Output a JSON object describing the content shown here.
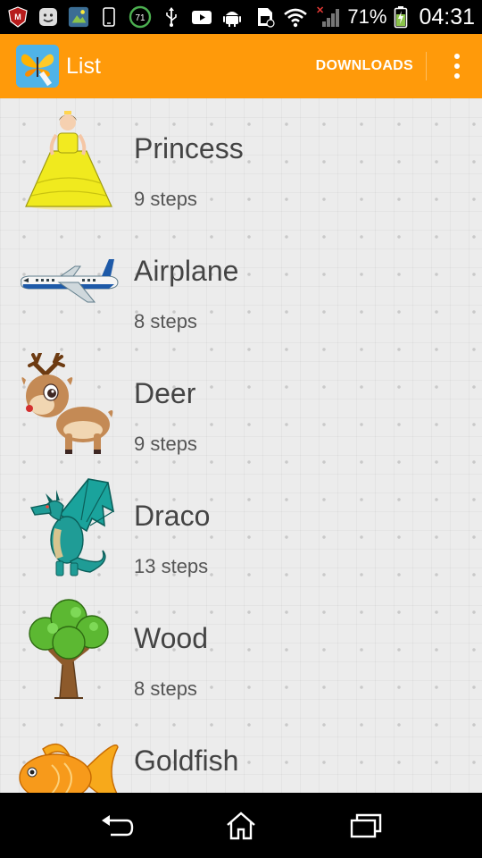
{
  "status_bar": {
    "battery_percent": "71%",
    "time": "04:31",
    "icons": [
      "mcafee-icon",
      "smiley-icon",
      "gallery-icon",
      "phone-icon",
      "data-counter-icon",
      "usb-icon",
      "youtube-icon",
      "android-icon",
      "sim-icon",
      "wifi-icon",
      "signal-icon",
      "battery-icon"
    ],
    "data_counter": "71"
  },
  "app_bar": {
    "title": "List",
    "downloads_label": "DOWNLOADS",
    "accent_color": "#ff9a0a"
  },
  "items": [
    {
      "title": "Princess",
      "steps": "9 steps",
      "icon": "princess-icon"
    },
    {
      "title": "Airplane",
      "steps": "8 steps",
      "icon": "airplane-icon"
    },
    {
      "title": "Deer",
      "steps": "9 steps",
      "icon": "deer-icon"
    },
    {
      "title": "Draco",
      "steps": "13 steps",
      "icon": "dragon-icon"
    },
    {
      "title": "Wood",
      "steps": "8 steps",
      "icon": "tree-icon"
    },
    {
      "title": "Goldfish",
      "steps": "",
      "icon": "goldfish-icon"
    }
  ],
  "nav_bar": {
    "buttons": [
      "back-icon",
      "home-icon",
      "recents-icon"
    ]
  }
}
